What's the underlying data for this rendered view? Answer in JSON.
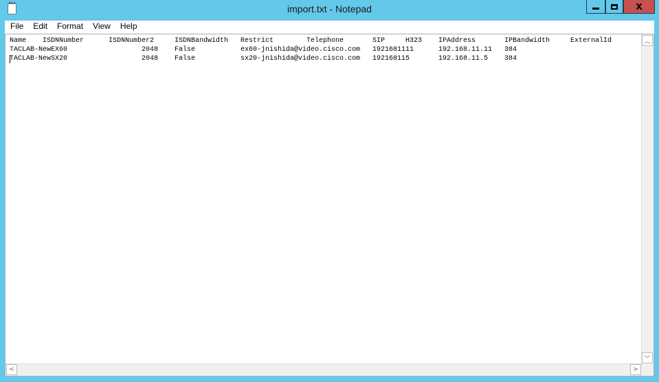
{
  "window": {
    "title": "import.txt - Notepad",
    "close_label": "X"
  },
  "menu": [
    "File",
    "Edit",
    "Format",
    "View",
    "Help"
  ],
  "document": {
    "header": [
      "Name",
      "ISDNNumber",
      "ISDNNumber2",
      "ISDNBandwidth",
      "Restrict",
      "Telephone",
      "SIP",
      "H323",
      "IPAddress",
      "IPBandwidth",
      "ExternalId"
    ],
    "rows": [
      [
        "TACLAB-NewEX60",
        "",
        "2048",
        "False",
        "ex60-jnishida@video.cisco.com",
        "",
        "1921681111",
        "",
        "192.168.11.11",
        "384",
        ""
      ],
      [
        "TACLAB-NewSX20",
        "",
        "2048",
        "False",
        "sx20-jnishida@video.cisco.com",
        "",
        "192168115",
        "",
        "192.168.11.5",
        "384",
        ""
      ]
    ]
  }
}
